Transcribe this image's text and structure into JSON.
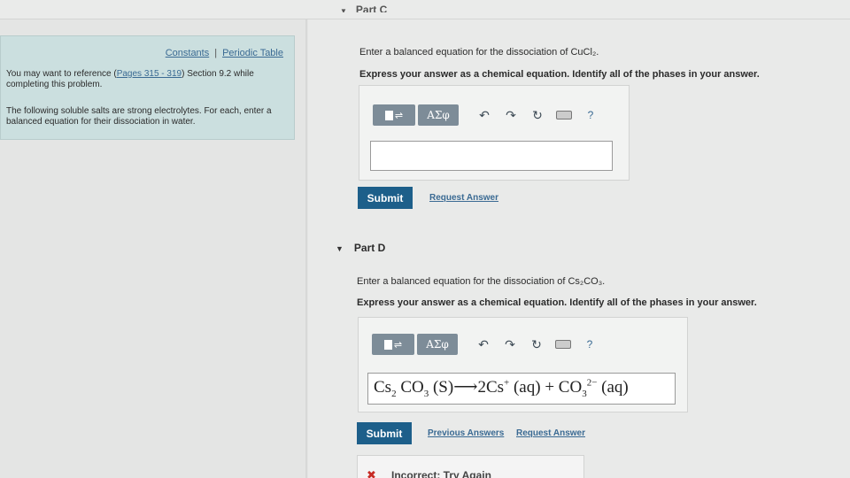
{
  "part_c": {
    "header": "Part C",
    "prompt": "Enter a balanced equation for the dissociation of CuCl₂.",
    "instruction": "Express your answer as a chemical equation. Identify all of the phases in your answer.",
    "answer_value": "",
    "submit_label": "Submit",
    "request_answer_label": "Request Answer"
  },
  "sidebar": {
    "constants_link": "Constants",
    "separator": "|",
    "periodic_table_link": "Periodic Table",
    "ref_prefix": "You may want to reference (",
    "ref_pages": "Pages 315 - 319",
    "ref_suffix": ") Section 9.2 while completing this problem.",
    "intro": "The following soluble salts are strong electrolytes. For each, enter a balanced equation for their dissociation in water."
  },
  "toolbar": {
    "greek_label": "ΑΣφ",
    "undo_icon": "↶",
    "redo_icon": "↷",
    "reset_icon": "↻",
    "help_label": "?"
  },
  "part_d": {
    "header": "Part D",
    "prompt": "Enter a balanced equation for the dissociation of Cs₂CO₃.",
    "instruction": "Express your answer as a chemical equation. Identify all of the phases in your answer.",
    "answer": {
      "t1": "Cs",
      "s1": "2",
      "t2": " CO",
      "s2": "3",
      "t3": " (S)⟶2Cs",
      "p1": "+",
      "t4": " (aq) + CO",
      "s3": "3",
      "p2": "2−",
      "t5": " (aq)"
    },
    "submit_label": "Submit",
    "previous_answers_label": "Previous Answers",
    "request_answer_label": "Request Answer",
    "feedback": "Incorrect; Try Again",
    "feedback_icon": "✖"
  },
  "colors": {
    "submit": "#1d5f8a",
    "link": "#3a6a93",
    "sidebar_bg": "#cbdfdf",
    "error": "#c72b24"
  }
}
